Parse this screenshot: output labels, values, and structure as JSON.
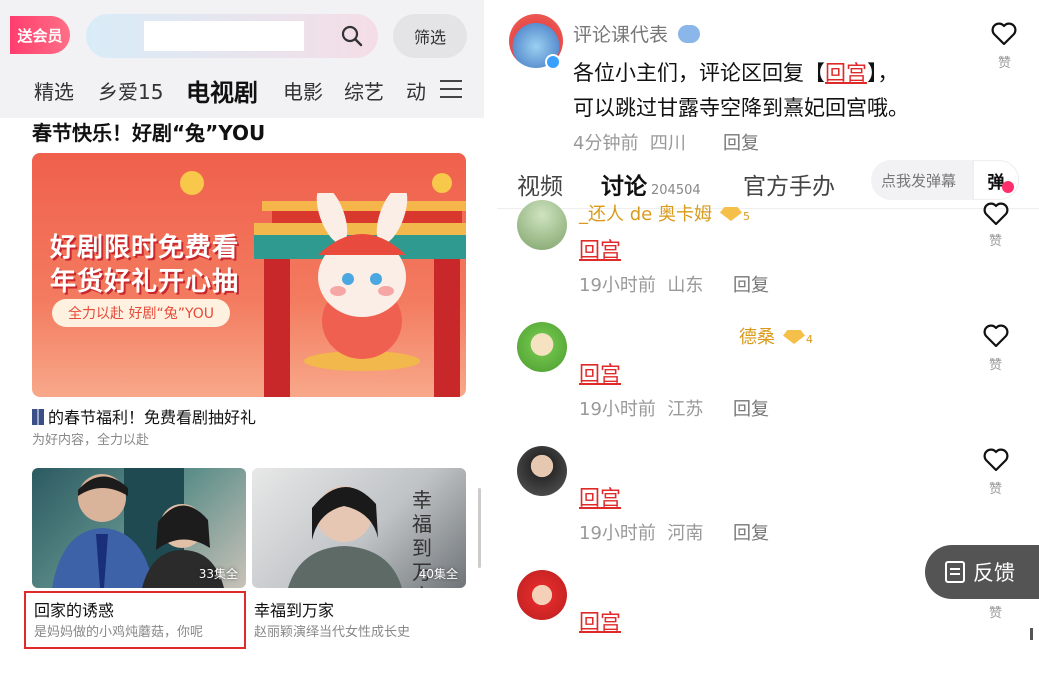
{
  "left": {
    "vip_label": "送会员",
    "filter_label": "筛选",
    "channels": [
      "精选",
      "乡爱15",
      "电视剧",
      "电影",
      "综艺",
      "动"
    ],
    "active_channel": "电视剧",
    "section_title": "春节快乐！好剧“兔”YOU",
    "banner": {
      "line1": "好剧限时免费看",
      "line2": "年货好礼开心抽",
      "pill": "全力以赴 好剧“兔”YOU"
    },
    "featured": {
      "title": "的春节福利！免费看剧抽好礼",
      "subtitle": "为好内容，全力以赴"
    },
    "dramas": [
      {
        "title": "回家的诱惑",
        "subtitle": "是妈妈做的小鸡炖蘑菇，你呢",
        "episodes": "33集全",
        "highlighted": true
      },
      {
        "title": "幸福到万家",
        "subtitle": "赵丽颖演绎当代女性成长史",
        "episodes": "40集全",
        "highlighted": false
      }
    ],
    "thumb2_overlay": "幸福到万家"
  },
  "right": {
    "top_comment": {
      "username": "评论课代表",
      "text_prefix": "各位小主们，评论区回复【",
      "text_link": "回宫",
      "text_suffix": "】，",
      "line2": "可以跳过甘露寺空降到熹妃回宫哦。",
      "time": "4分钟前",
      "location": "四川",
      "reply": "回复",
      "like": "赞"
    },
    "tabs": [
      {
        "label": "视频"
      },
      {
        "label": "讨论",
        "count": "204504"
      },
      {
        "label": "官方手办"
      }
    ],
    "danmu_placeholder": "点我发弹幕",
    "danmu_button": "弹",
    "comments": [
      {
        "name": "_还人 de 奥卡姆",
        "level": "5",
        "text": "回宫",
        "time": "19小时前",
        "location": "山东",
        "reply": "回复",
        "like": "赞"
      },
      {
        "name": "德桑",
        "level": "4",
        "text": "回宫",
        "time": "19小时前",
        "location": "江苏",
        "reply": "回复",
        "like": "赞"
      },
      {
        "name": "",
        "level": "",
        "text": "回宫",
        "time": "19小时前",
        "location": "河南",
        "reply": "回复",
        "like": "赞"
      },
      {
        "name": "",
        "level": "",
        "text": "回宫",
        "time": "",
        "location": "",
        "reply": "",
        "like": "赞"
      }
    ],
    "feedback_label": "反馈"
  },
  "colors": {
    "accent_red": "#e02a2a",
    "vip_pink": "#ff3d6e",
    "level_gold": "#d99a1a",
    "feedback_bg": "#545454"
  }
}
